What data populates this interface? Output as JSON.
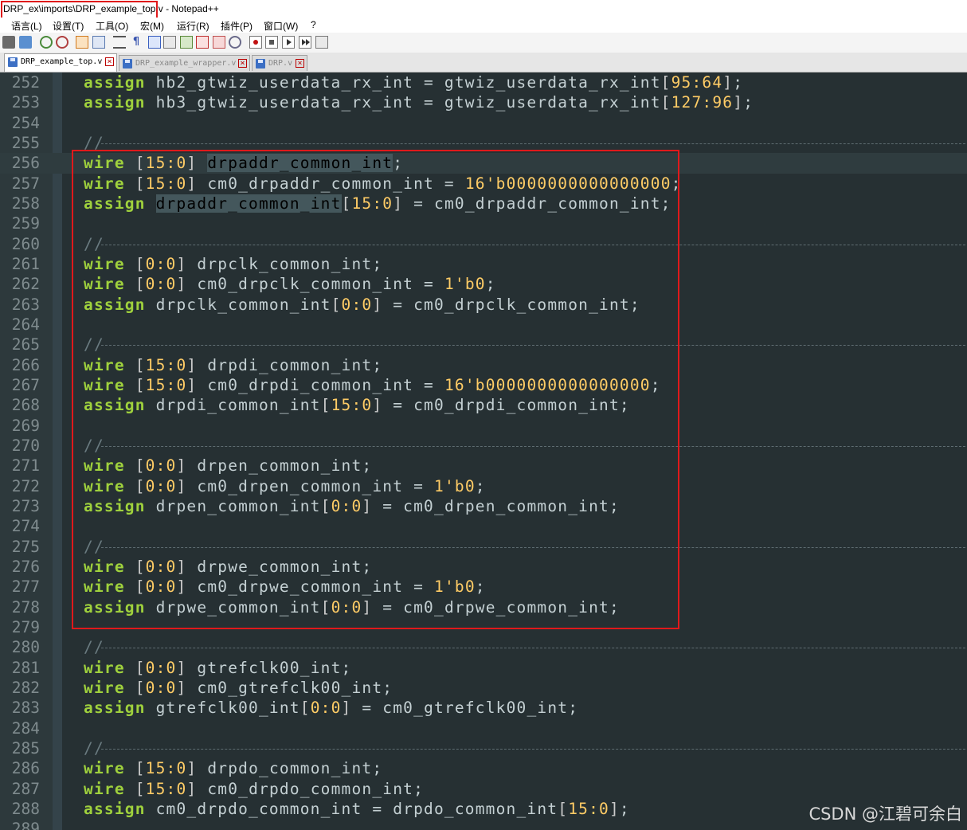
{
  "window": {
    "title": "DRP_ex\\imports\\DRP_example_top.v - Notepad++"
  },
  "menu": [
    "语言(L)",
    "设置(T)",
    "工具(O)",
    "宏(M)",
    "运行(R)",
    "插件(P)",
    "窗口(W)",
    "?"
  ],
  "tabs": [
    {
      "label": "DRP_example_top.v",
      "active": true
    },
    {
      "label": "DRP_example_wrapper.v",
      "active": false
    },
    {
      "label": "DRP.v",
      "active": false
    }
  ],
  "editor": {
    "lines": [
      {
        "n": "252",
        "t": [
          [
            "kw",
            "assign"
          ],
          [
            "id",
            " hb2_gtwiz_userdata_rx_int = gtwiz_userdata_rx_int"
          ],
          [
            "br",
            "["
          ],
          [
            "num",
            "95:64"
          ],
          [
            "br",
            "]"
          ],
          [
            "op",
            ";"
          ]
        ]
      },
      {
        "n": "253",
        "t": [
          [
            "kw",
            "assign"
          ],
          [
            "id",
            " hb3_gtwiz_userdata_rx_int = gtwiz_userdata_rx_int"
          ],
          [
            "br",
            "["
          ],
          [
            "num",
            "127:96"
          ],
          [
            "br",
            "]"
          ],
          [
            "op",
            ";"
          ]
        ]
      },
      {
        "n": "254",
        "t": []
      },
      {
        "n": "255",
        "t": [
          [
            "cm",
            "//"
          ]
        ],
        "divider": true
      },
      {
        "n": "256",
        "t": [
          [
            "kw",
            "wire"
          ],
          [
            "br",
            " ["
          ],
          [
            "num",
            "15:0"
          ],
          [
            "br",
            "]"
          ],
          [
            "id",
            " "
          ],
          [
            "hl",
            "drpaddr_common_int"
          ],
          [
            "op",
            ";"
          ]
        ],
        "current": true
      },
      {
        "n": "257",
        "t": [
          [
            "kw",
            "wire"
          ],
          [
            "br",
            " ["
          ],
          [
            "num",
            "15:0"
          ],
          [
            "br",
            "]"
          ],
          [
            "id",
            " cm0_drpaddr_common_int = "
          ],
          [
            "num",
            "16'b0000000000000000"
          ],
          [
            "op",
            ";"
          ]
        ]
      },
      {
        "n": "258",
        "t": [
          [
            "kw",
            "assign"
          ],
          [
            "id",
            " "
          ],
          [
            "hl",
            "drpaddr_common_int"
          ],
          [
            "br",
            "["
          ],
          [
            "num",
            "15:0"
          ],
          [
            "br",
            "]"
          ],
          [
            "id",
            " = cm0_drpaddr_common_int;"
          ]
        ]
      },
      {
        "n": "259",
        "t": []
      },
      {
        "n": "260",
        "t": [
          [
            "cm",
            "//"
          ]
        ],
        "divider": true
      },
      {
        "n": "261",
        "t": [
          [
            "kw",
            "wire"
          ],
          [
            "br",
            " ["
          ],
          [
            "num",
            "0:0"
          ],
          [
            "br",
            "]"
          ],
          [
            "id",
            " drpclk_common_int;"
          ]
        ]
      },
      {
        "n": "262",
        "t": [
          [
            "kw",
            "wire"
          ],
          [
            "br",
            " ["
          ],
          [
            "num",
            "0:0"
          ],
          [
            "br",
            "]"
          ],
          [
            "id",
            " cm0_drpclk_common_int = "
          ],
          [
            "num",
            "1'b0"
          ],
          [
            "op",
            ";"
          ]
        ]
      },
      {
        "n": "263",
        "t": [
          [
            "kw",
            "assign"
          ],
          [
            "id",
            " drpclk_common_int"
          ],
          [
            "br",
            "["
          ],
          [
            "num",
            "0:0"
          ],
          [
            "br",
            "]"
          ],
          [
            "id",
            " = cm0_drpclk_common_int;"
          ]
        ]
      },
      {
        "n": "264",
        "t": []
      },
      {
        "n": "265",
        "t": [
          [
            "cm",
            "//"
          ]
        ],
        "divider": true
      },
      {
        "n": "266",
        "t": [
          [
            "kw",
            "wire"
          ],
          [
            "br",
            " ["
          ],
          [
            "num",
            "15:0"
          ],
          [
            "br",
            "]"
          ],
          [
            "id",
            " drpdi_common_int;"
          ]
        ]
      },
      {
        "n": "267",
        "t": [
          [
            "kw",
            "wire"
          ],
          [
            "br",
            " ["
          ],
          [
            "num",
            "15:0"
          ],
          [
            "br",
            "]"
          ],
          [
            "id",
            " cm0_drpdi_common_int = "
          ],
          [
            "num",
            "16'b0000000000000000"
          ],
          [
            "op",
            ";"
          ]
        ]
      },
      {
        "n": "268",
        "t": [
          [
            "kw",
            "assign"
          ],
          [
            "id",
            " drpdi_common_int"
          ],
          [
            "br",
            "["
          ],
          [
            "num",
            "15:0"
          ],
          [
            "br",
            "]"
          ],
          [
            "id",
            " = cm0_drpdi_common_int;"
          ]
        ]
      },
      {
        "n": "269",
        "t": []
      },
      {
        "n": "270",
        "t": [
          [
            "cm",
            "//"
          ]
        ],
        "divider": true
      },
      {
        "n": "271",
        "t": [
          [
            "kw",
            "wire"
          ],
          [
            "br",
            " ["
          ],
          [
            "num",
            "0:0"
          ],
          [
            "br",
            "]"
          ],
          [
            "id",
            " drpen_common_int;"
          ]
        ]
      },
      {
        "n": "272",
        "t": [
          [
            "kw",
            "wire"
          ],
          [
            "br",
            " ["
          ],
          [
            "num",
            "0:0"
          ],
          [
            "br",
            "]"
          ],
          [
            "id",
            " cm0_drpen_common_int = "
          ],
          [
            "num",
            "1'b0"
          ],
          [
            "op",
            ";"
          ]
        ]
      },
      {
        "n": "273",
        "t": [
          [
            "kw",
            "assign"
          ],
          [
            "id",
            " drpen_common_int"
          ],
          [
            "br",
            "["
          ],
          [
            "num",
            "0:0"
          ],
          [
            "br",
            "]"
          ],
          [
            "id",
            " = cm0_drpen_common_int;"
          ]
        ]
      },
      {
        "n": "274",
        "t": []
      },
      {
        "n": "275",
        "t": [
          [
            "cm",
            "//"
          ]
        ],
        "divider": true
      },
      {
        "n": "276",
        "t": [
          [
            "kw",
            "wire"
          ],
          [
            "br",
            " ["
          ],
          [
            "num",
            "0:0"
          ],
          [
            "br",
            "]"
          ],
          [
            "id",
            " drpwe_common_int;"
          ]
        ]
      },
      {
        "n": "277",
        "t": [
          [
            "kw",
            "wire"
          ],
          [
            "br",
            " ["
          ],
          [
            "num",
            "0:0"
          ],
          [
            "br",
            "]"
          ],
          [
            "id",
            " cm0_drpwe_common_int = "
          ],
          [
            "num",
            "1'b0"
          ],
          [
            "op",
            ";"
          ]
        ]
      },
      {
        "n": "278",
        "t": [
          [
            "kw",
            "assign"
          ],
          [
            "id",
            " drpwe_common_int"
          ],
          [
            "br",
            "["
          ],
          [
            "num",
            "0:0"
          ],
          [
            "br",
            "]"
          ],
          [
            "id",
            " = cm0_drpwe_common_int;"
          ]
        ]
      },
      {
        "n": "279",
        "t": []
      },
      {
        "n": "280",
        "t": [
          [
            "cm",
            "//"
          ]
        ],
        "divider": true
      },
      {
        "n": "281",
        "t": [
          [
            "kw",
            "wire"
          ],
          [
            "br",
            " ["
          ],
          [
            "num",
            "0:0"
          ],
          [
            "br",
            "]"
          ],
          [
            "id",
            " gtrefclk00_int;"
          ]
        ]
      },
      {
        "n": "282",
        "t": [
          [
            "kw",
            "wire"
          ],
          [
            "br",
            " ["
          ],
          [
            "num",
            "0:0"
          ],
          [
            "br",
            "]"
          ],
          [
            "id",
            " cm0_gtrefclk00_int;"
          ]
        ]
      },
      {
        "n": "283",
        "t": [
          [
            "kw",
            "assign"
          ],
          [
            "id",
            " gtrefclk00_int"
          ],
          [
            "br",
            "["
          ],
          [
            "num",
            "0:0"
          ],
          [
            "br",
            "]"
          ],
          [
            "id",
            " = cm0_gtrefclk00_int;"
          ]
        ]
      },
      {
        "n": "284",
        "t": []
      },
      {
        "n": "285",
        "t": [
          [
            "cm",
            "//"
          ]
        ],
        "divider": true
      },
      {
        "n": "286",
        "t": [
          [
            "kw",
            "wire"
          ],
          [
            "br",
            " ["
          ],
          [
            "num",
            "15:0"
          ],
          [
            "br",
            "]"
          ],
          [
            "id",
            " drpdo_common_int;"
          ]
        ]
      },
      {
        "n": "287",
        "t": [
          [
            "kw",
            "wire"
          ],
          [
            "br",
            " ["
          ],
          [
            "num",
            "15:0"
          ],
          [
            "br",
            "]"
          ],
          [
            "id",
            " cm0_drpdo_common_int;"
          ]
        ]
      },
      {
        "n": "288",
        "t": [
          [
            "kw",
            "assign"
          ],
          [
            "id",
            " cm0_drpdo_common_int = drpdo_common_int"
          ],
          [
            "br",
            "["
          ],
          [
            "num",
            "15:0"
          ],
          [
            "br",
            "]"
          ],
          [
            "op",
            ";"
          ]
        ]
      },
      {
        "n": "289",
        "t": []
      }
    ]
  },
  "watermark": "CSDN @江碧可余白"
}
